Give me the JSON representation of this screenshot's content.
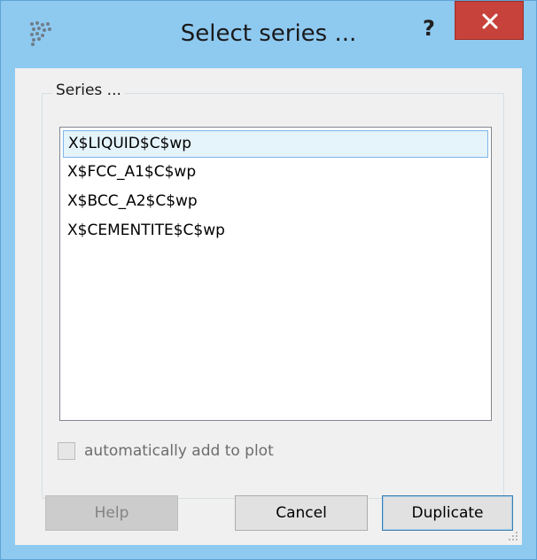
{
  "window": {
    "title": "Select series ...",
    "help_glyph": "?",
    "app_icon": "grid-dots-icon",
    "close_icon": "close-icon",
    "accent": "#8ec9f0",
    "close_color": "#c7423a"
  },
  "group": {
    "title": "Series ..."
  },
  "series": {
    "items": [
      {
        "label": "X$LIQUID$C$wp",
        "selected": true
      },
      {
        "label": "X$FCC_A1$C$wp",
        "selected": false
      },
      {
        "label": "X$BCC_A2$C$wp",
        "selected": false
      },
      {
        "label": "X$CEMENTITE$C$wp",
        "selected": false
      }
    ]
  },
  "option": {
    "label": "automatically add to plot",
    "checked": false,
    "enabled": false
  },
  "buttons": {
    "help": "Help",
    "cancel": "Cancel",
    "duplicate": "Duplicate"
  }
}
